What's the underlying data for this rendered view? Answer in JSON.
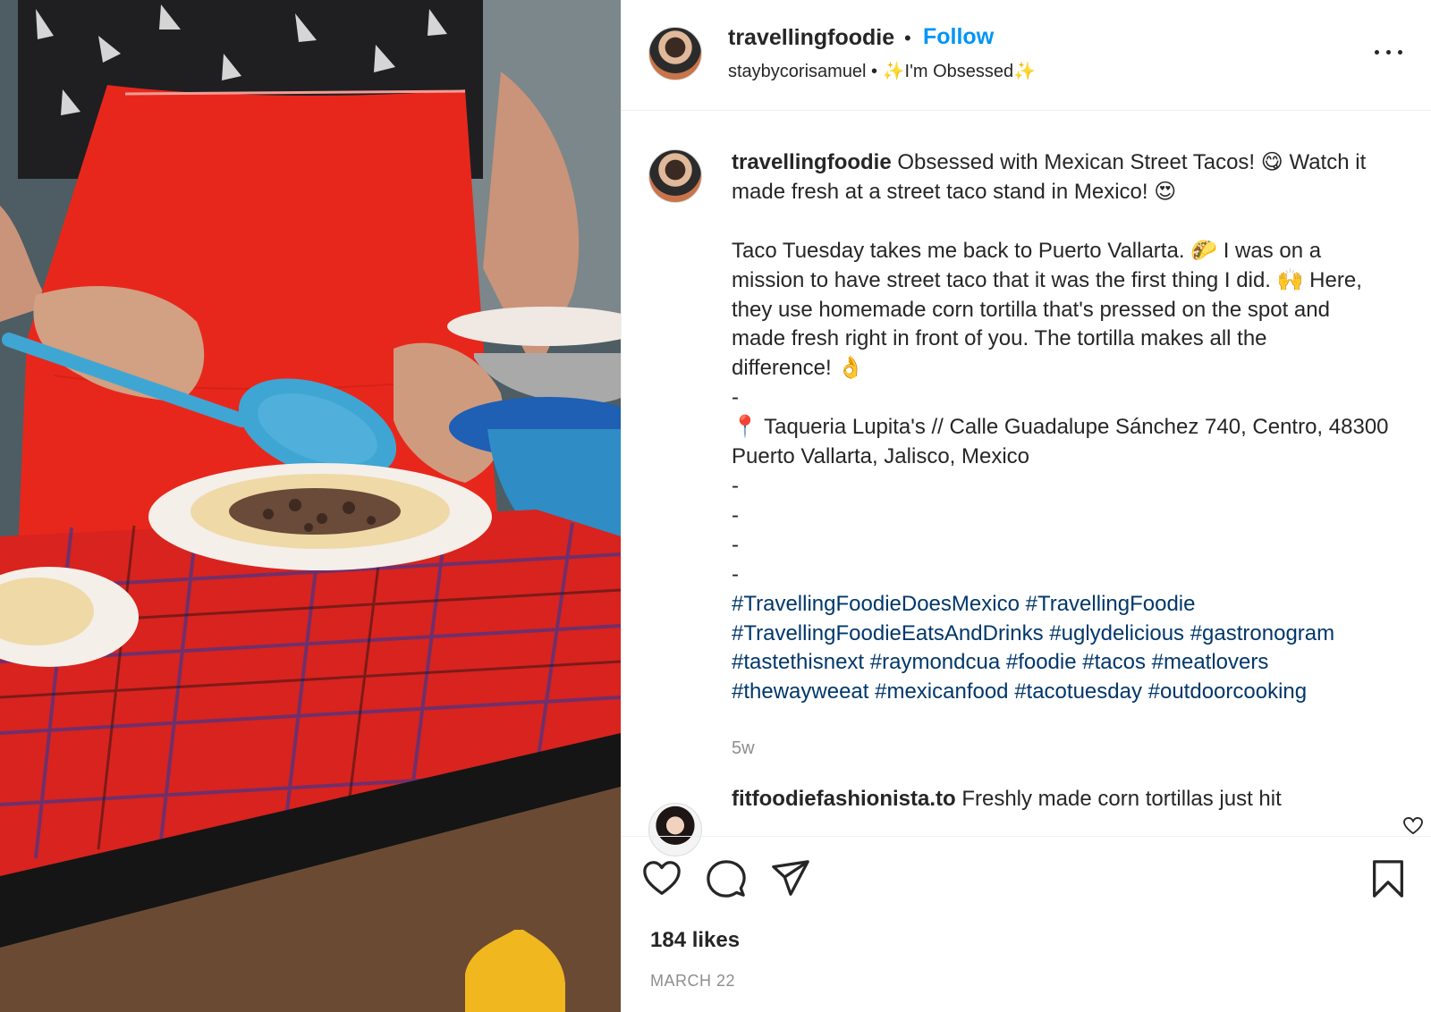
{
  "header": {
    "username": "travellingfoodie",
    "dot": "•",
    "follow_label": "Follow",
    "subline": "staybycorisamuel • ✨I'm Obsessed✨"
  },
  "caption": {
    "username": "travellingfoodie",
    "lines": [
      " Obsessed with Mexican Street Tacos! 😋 Watch it",
      "made fresh at a street taco stand in Mexico! 😍",
      "",
      "Taco Tuesday takes me back to Puerto Vallarta. 🌮 I was on a",
      "mission to have street taco that it was the first thing I did. 🙌 Here,",
      "they use homemade corn tortilla that's pressed on the spot and",
      "made fresh right in front of you. The tortilla makes all the",
      "difference! 👌",
      "-",
      "📍 Taqueria Lupita's // Calle Guadalupe Sánchez 740, Centro, 48300",
      "Puerto Vallarta, Jalisco, Mexico",
      "-",
      "-",
      "-",
      "-"
    ],
    "hashtag_lines": [
      "#TravellingFoodieDoesMexico #TravellingFoodie",
      "#TravellingFoodieEatsAndDrinks #uglydelicious #gastronogram",
      "#tastethisnext #raymondcua #foodie #tacos #meatlovers",
      "#thewayweeat #mexicanfood #tacotuesday #outdoorcooking"
    ],
    "time_ago": "5w"
  },
  "comment": {
    "username": "fitfoodiefashionista.to",
    "text": " Freshly made corn tortillas just hit"
  },
  "actions": {
    "icons": [
      "heart-icon",
      "comment-icon",
      "share-icon",
      "bookmark-icon"
    ]
  },
  "likes": "184 likes",
  "date": "MARCH 22",
  "colors": {
    "follow": "#0095f6",
    "hashtag": "#00376b",
    "muted": "#8e8e8e",
    "apron": "#e8271c",
    "spoon": "#3fa6d4"
  }
}
